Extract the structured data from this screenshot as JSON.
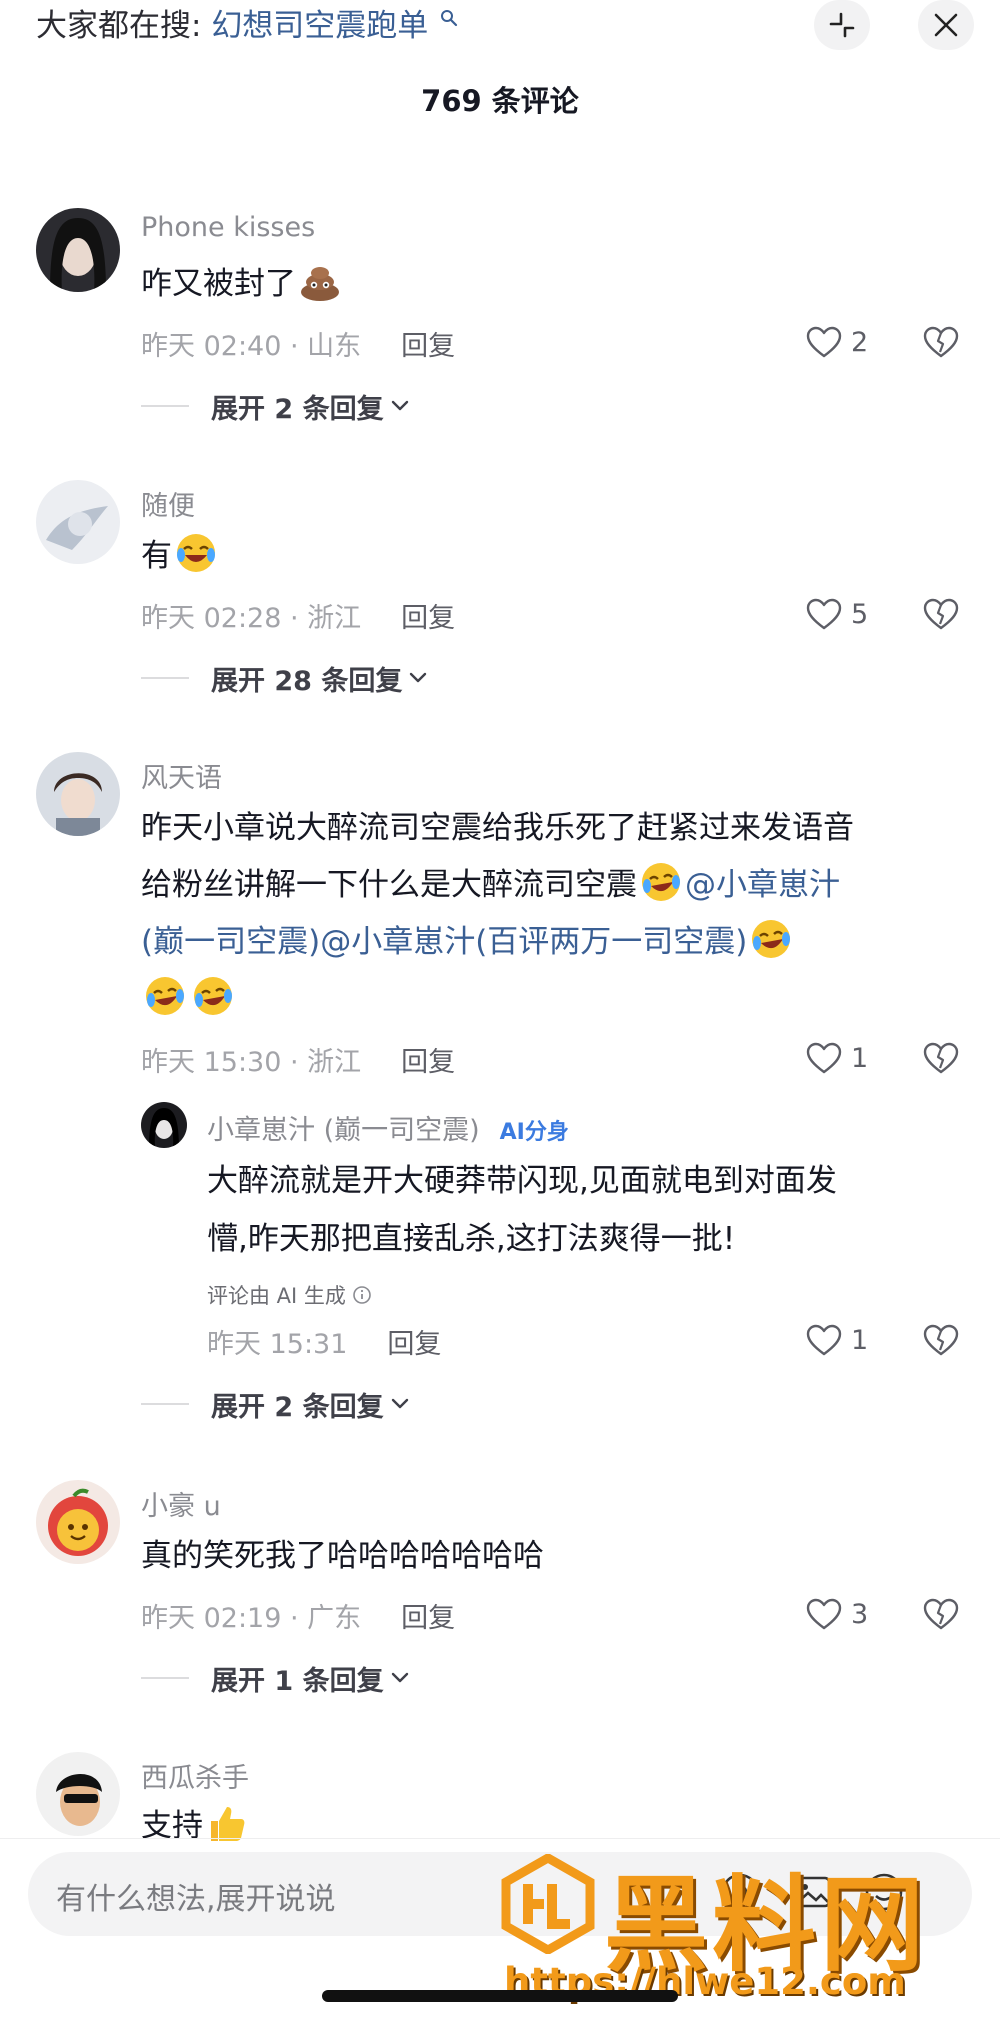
{
  "header": {
    "search_prefix": "大家都在搜:",
    "search_keyword": "幻想司空震跑单",
    "comment_count": "769 条评论"
  },
  "comments": [
    {
      "user": "Phone kisses",
      "text": "咋又被封了",
      "emoji": "poop-emoji",
      "time_location": "昨天 02:40 · 山东",
      "reply_label": "回复",
      "likes": "2",
      "expand": "展开 2 条回复"
    },
    {
      "user": "随便",
      "text": "有",
      "emoji": "laugh-emoji",
      "time_location": "昨天 02:28 · 浙江",
      "reply_label": "回复",
      "likes": "5",
      "expand": "展开 28 条回复"
    },
    {
      "user": "风天语",
      "text_line1": "昨天小章说大醉流司空震给我乐死了赶紧过来发语音",
      "text_line2": "给粉丝讲解一下什么是大醉流司空震",
      "mention1": "@小章崽汁",
      "mention1_cont": "(巅一司空震)",
      "mention2": "@小章崽汁(百评两万一司空震)",
      "emoji": "rofl-emoji",
      "time_location": "昨天 15:30 · 浙江",
      "reply_label": "回复",
      "likes": "1",
      "sub_reply": {
        "user": "小章崽汁 (巅一司空震)",
        "ai_tag": "AI分身",
        "text_line1": "大醉流就是开大硬莽带闪现,见面就电到对面发",
        "text_line2": "懵,昨天那把直接乱杀,这打法爽得一批!",
        "ai_note": "评论由 AI 生成",
        "time": "昨天 15:31",
        "reply_label": "回复",
        "likes": "1"
      },
      "expand": "展开 2 条回复"
    },
    {
      "user": "小豪 u",
      "text": "真的笑死我了哈哈哈哈哈哈哈",
      "time_location": "昨天 02:19 · 广东",
      "reply_label": "回复",
      "likes": "3",
      "expand": "展开 1 条回复"
    },
    {
      "user": "西瓜杀手",
      "text": "支持",
      "emoji": "thumbs-up-emoji"
    }
  ],
  "input": {
    "placeholder": "有什么想法,展开说说"
  },
  "watermark": {
    "title": "黑料网",
    "url": "https://hlwe12.com"
  },
  "colors": {
    "mention": "#3a5f94",
    "ai_tag": "#3b7be0",
    "watermark": "#f29a1a"
  }
}
